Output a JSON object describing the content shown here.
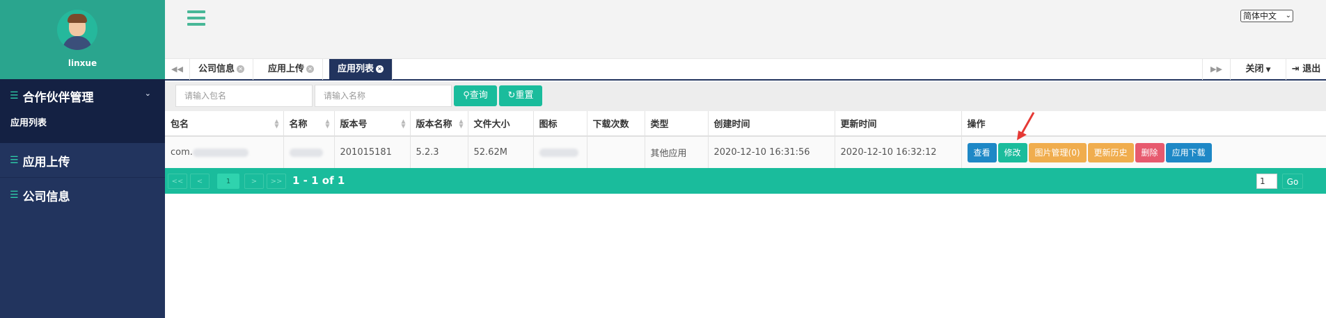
{
  "user": {
    "name": "linxue"
  },
  "sidebar": {
    "groups": [
      {
        "label": "合作伙伴管理",
        "items": [
          "应用列表"
        ]
      },
      {
        "label": "应用上传"
      },
      {
        "label": "公司信息"
      }
    ]
  },
  "header": {
    "language": "简体中文"
  },
  "tabs": [
    {
      "label": "公司信息"
    },
    {
      "label": "应用上传"
    },
    {
      "label": "应用列表",
      "active": true
    }
  ],
  "tab_actions": {
    "close": "关闭",
    "logout": "退出"
  },
  "search": {
    "package_placeholder": "请输入包名",
    "name_placeholder": "请输入名称",
    "query_label": "查询",
    "reset_label": "重置"
  },
  "table": {
    "columns": [
      "包名",
      "名称",
      "版本号",
      "版本名称",
      "文件大小",
      "图标",
      "下载次数",
      "类型",
      "创建时间",
      "更新时间",
      "操作"
    ],
    "rows": [
      {
        "package": "com.",
        "name": "",
        "version_code": "201015181",
        "version_name": "5.2.3",
        "file_size": "52.62M",
        "downloads": "",
        "type": "其他应用",
        "created": "2020-12-10 16:31:56",
        "updated": "2020-12-10 16:32:12"
      }
    ],
    "actions": [
      "查看",
      "修改",
      "图片管理(0)",
      "更新历史",
      "删除",
      "应用下载"
    ]
  },
  "pager": {
    "first": "<<",
    "prev": "<",
    "current": "1",
    "next": ">",
    "last": ">>",
    "info": "1 - 1 of 1",
    "goto_value": "1",
    "go_label": "Go"
  },
  "colors": {
    "accent": "#1abc9c",
    "sidebar": "#22345e",
    "delete": "#e75a6e",
    "warn": "#f0ad4e",
    "primary": "#1e88c6"
  }
}
